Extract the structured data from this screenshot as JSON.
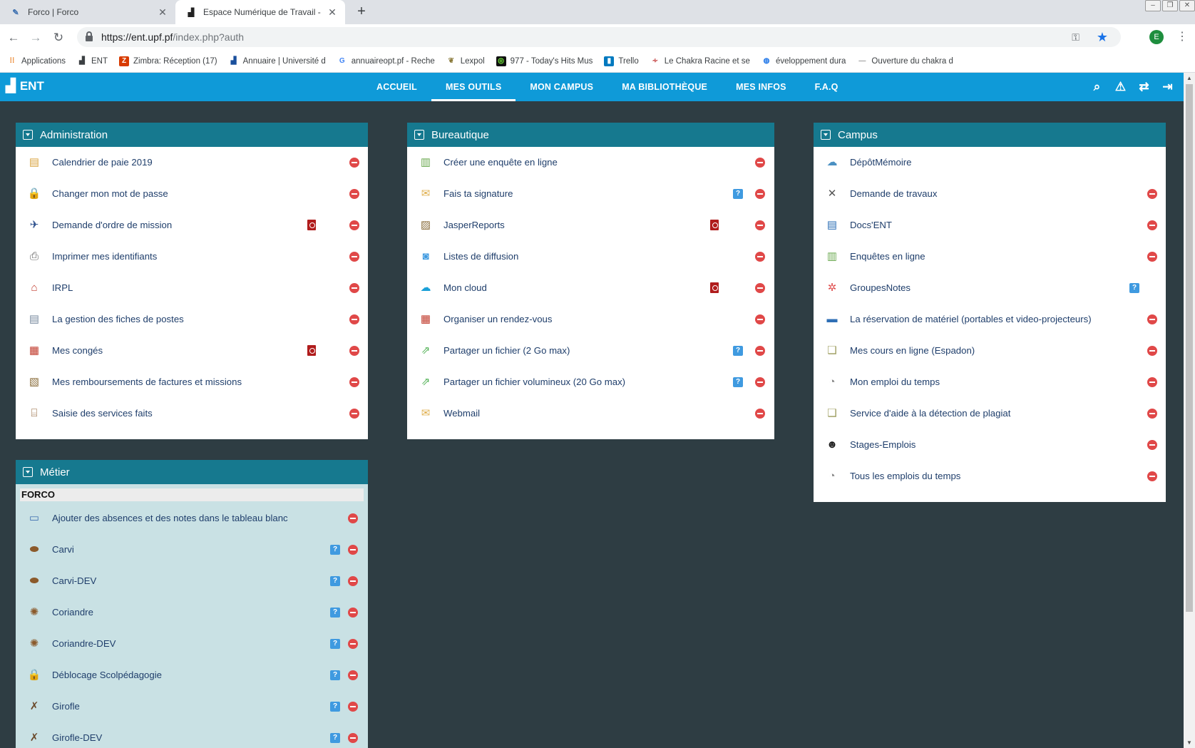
{
  "browser": {
    "tabs": [
      {
        "title": "Forco | Forco",
        "active": false
      },
      {
        "title": "Espace Numérique de Travail - Univ",
        "active": true
      }
    ],
    "url_host": "https://ent.upf.pf",
    "url_path": "/index.php?auth",
    "profile_initial": "E",
    "bookmarks": [
      {
        "label": "Applications",
        "icon": "apps-grid-icon"
      },
      {
        "label": "ENT",
        "icon": "ent-icon"
      },
      {
        "label": "Zimbra: Réception (17)",
        "icon": "zimbra-icon"
      },
      {
        "label": "Annuaire | Université d",
        "icon": "ent-icon"
      },
      {
        "label": "annuaireopt.pf - Reche",
        "icon": "google-icon"
      },
      {
        "label": "Lexpol",
        "icon": "lexpol-icon"
      },
      {
        "label": "977 - Today's Hits Mus",
        "icon": "radio-icon"
      },
      {
        "label": "Trello",
        "icon": "trello-icon"
      },
      {
        "label": "Le Chakra Racine et se",
        "icon": "chakra-icon"
      },
      {
        "label": "éveloppement dura",
        "icon": "globe-icon"
      },
      {
        "label": "Ouverture du chakra d",
        "icon": "chakra-icon"
      }
    ]
  },
  "topnav": {
    "logo": "ENT",
    "items": [
      {
        "label": "ACCUEIL",
        "active": false
      },
      {
        "label": "MES OUTILS",
        "active": true
      },
      {
        "label": "MON CAMPUS",
        "active": false
      },
      {
        "label": "MA BIBLIOTHÈQUE",
        "active": false
      },
      {
        "label": "MES INFOS",
        "active": false
      },
      {
        "label": "F.A.Q",
        "active": false
      }
    ]
  },
  "panels": {
    "administration": {
      "title": "Administration",
      "items": [
        {
          "label": "Calendrier de paie 2019",
          "icon": "calendar-pay-icon",
          "pdf": false,
          "info": false,
          "del": true
        },
        {
          "label": "Changer mon mot de passe",
          "icon": "padlock-icon",
          "pdf": false,
          "info": false,
          "del": true
        },
        {
          "label": "Demande d'ordre de mission",
          "icon": "airplane-icon",
          "pdf": true,
          "info": false,
          "del": true
        },
        {
          "label": "Imprimer mes identifiants",
          "icon": "printer-icon",
          "pdf": false,
          "info": false,
          "del": true
        },
        {
          "label": "IRPL",
          "icon": "house-icon",
          "pdf": false,
          "info": false,
          "del": true
        },
        {
          "label": "La gestion des fiches de postes",
          "icon": "document-icon",
          "pdf": false,
          "info": false,
          "del": true
        },
        {
          "label": "Mes congés",
          "icon": "calendar-14-icon",
          "pdf": true,
          "info": false,
          "del": true
        },
        {
          "label": "Mes remboursements de factures et missions",
          "icon": "receipt-icon",
          "pdf": false,
          "info": false,
          "del": true
        },
        {
          "label": "Saisie des services faits",
          "icon": "bank-icon",
          "pdf": false,
          "info": false,
          "del": true
        }
      ]
    },
    "bureautique": {
      "title": "Bureautique",
      "items": [
        {
          "label": "Créer une enquête en ligne",
          "icon": "survey-icon",
          "pdf": false,
          "info": false,
          "del": true
        },
        {
          "label": "Fais ta signature",
          "icon": "envelope-icon",
          "pdf": false,
          "info": true,
          "del": true
        },
        {
          "label": "JasperReports",
          "icon": "report-icon",
          "pdf": true,
          "info": false,
          "del": true
        },
        {
          "label": "Listes de diffusion",
          "icon": "mailing-list-icon",
          "pdf": false,
          "info": false,
          "del": true
        },
        {
          "label": "Mon cloud",
          "icon": "cloud-upload-icon",
          "pdf": true,
          "info": false,
          "del": true
        },
        {
          "label": "Organiser un rendez-vous",
          "icon": "calendar-15-icon",
          "pdf": false,
          "info": false,
          "del": true
        },
        {
          "label": "Partager un fichier (2 Go max)",
          "icon": "file-share-icon",
          "pdf": false,
          "info": true,
          "del": true
        },
        {
          "label": "Partager un fichier volumineux (20 Go max)",
          "icon": "file-share-icon",
          "pdf": false,
          "info": true,
          "del": true
        },
        {
          "label": "Webmail",
          "icon": "envelope-icon",
          "pdf": false,
          "info": false,
          "del": true
        }
      ]
    },
    "campus": {
      "title": "Campus",
      "items": [
        {
          "label": "DépôtMémoire",
          "icon": "cloud-icon",
          "pdf": false,
          "info": false,
          "del": false
        },
        {
          "label": "Demande de travaux",
          "icon": "tools-icon",
          "pdf": false,
          "info": false,
          "del": true
        },
        {
          "label": "Docs'ENT",
          "icon": "document-blue-icon",
          "pdf": false,
          "info": false,
          "del": true
        },
        {
          "label": "Enquêtes en ligne",
          "icon": "survey-icon",
          "pdf": false,
          "info": false,
          "del": true
        },
        {
          "label": "GroupesNotes",
          "icon": "asterisk-icon",
          "pdf": false,
          "info": true,
          "del": false
        },
        {
          "label": "La réservation de matériel (portables et video-projecteurs)",
          "icon": "projector-icon",
          "pdf": false,
          "info": false,
          "del": true
        },
        {
          "label": "Mes cours en ligne (Espadon)",
          "icon": "book-icon",
          "pdf": false,
          "info": false,
          "del": true
        },
        {
          "label": "Mon emploi du temps",
          "icon": "clock-icon",
          "pdf": false,
          "info": false,
          "del": true
        },
        {
          "label": "Service d'aide à la détection de plagiat",
          "icon": "book-icon",
          "pdf": false,
          "info": false,
          "del": true
        },
        {
          "label": "Stages-Emplois",
          "icon": "person-icon",
          "pdf": false,
          "info": false,
          "del": true
        },
        {
          "label": "Tous les emplois du temps",
          "icon": "clock-icon",
          "pdf": false,
          "info": false,
          "del": true
        }
      ]
    },
    "metier": {
      "title": "Métier",
      "group": "FORCO",
      "items": [
        {
          "label": "Ajouter des absences et des notes dans le tableau blanc",
          "icon": "whiteboard-icon",
          "pdf": false,
          "info": false,
          "del": true
        },
        {
          "label": "Carvi",
          "icon": "seed-icon",
          "pdf": false,
          "info": true,
          "del": true
        },
        {
          "label": "Carvi-DEV",
          "icon": "seed-icon",
          "pdf": false,
          "info": true,
          "del": true
        },
        {
          "label": "Coriandre",
          "icon": "spice-icon",
          "pdf": false,
          "info": true,
          "del": true
        },
        {
          "label": "Coriandre-DEV",
          "icon": "spice-icon",
          "pdf": false,
          "info": true,
          "del": true
        },
        {
          "label": "Déblocage Scolpédagogie",
          "icon": "padlock-icon",
          "pdf": false,
          "info": true,
          "del": true
        },
        {
          "label": "Girofle",
          "icon": "clove-icon",
          "pdf": false,
          "info": true,
          "del": true
        },
        {
          "label": "Girofle-DEV",
          "icon": "clove-icon",
          "pdf": false,
          "info": true,
          "del": true
        }
      ]
    }
  }
}
